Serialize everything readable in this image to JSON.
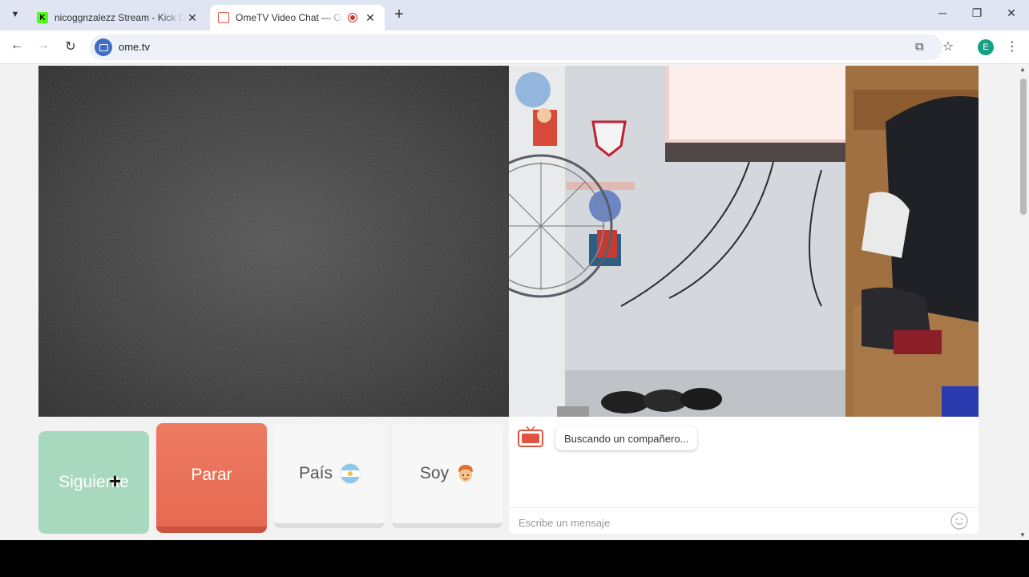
{
  "browser": {
    "tabs": [
      {
        "title": "nicoggnzalezz Stream - Kick Dashboard",
        "active": false
      },
      {
        "title": "OmeTV Video Chat — OmeTV",
        "active": true
      }
    ],
    "url": "ome.tv",
    "profile_initial": "E",
    "icons": {
      "tab_search": "chevron-down-icon",
      "close": "close-icon",
      "new_tab": "plus-icon",
      "minimize": "minimize-icon",
      "maximize": "maximize-icon",
      "back": "back-arrow-icon",
      "forward": "forward-arrow-icon",
      "reload": "reload-icon",
      "install": "install-app-icon",
      "bookmark": "star-icon",
      "menu": "kebab-menu-icon"
    }
  },
  "ometv": {
    "buttons": {
      "next": "Siguiente",
      "stop": "Parar",
      "country": "País",
      "gender": "Soy"
    },
    "chat": {
      "status_message": "Buscando un compañero...",
      "input_placeholder": "Escribe un mensaje"
    },
    "colors": {
      "next_bg": "#a8d9be",
      "stop_bg": "#e66a52",
      "neutral_bg": "#f7f7f7"
    }
  }
}
